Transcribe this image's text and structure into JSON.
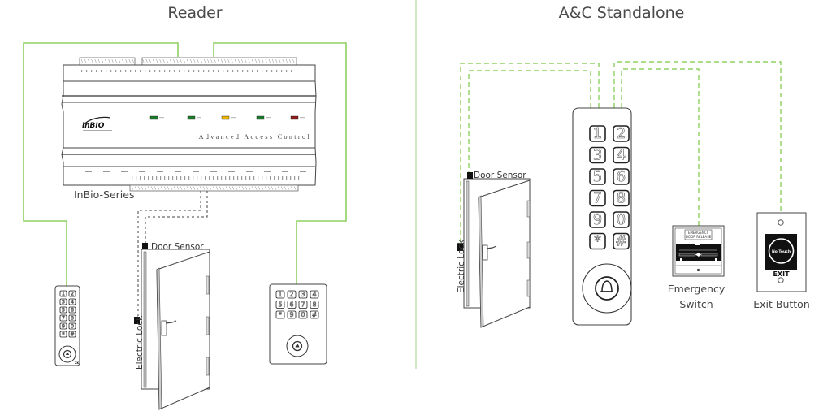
{
  "diagram": {
    "panels": [
      {
        "title": "Reader",
        "controller": {
          "series_label": "InBio-Series",
          "brand_text": "Advanced Access Control",
          "logo": "inBIO",
          "leds": [
            {
              "color": "#1a7a2a"
            },
            {
              "color": "#1a7a2a"
            },
            {
              "color": "#e8b400"
            },
            {
              "color": "#1a7a2a"
            },
            {
              "color": "#8b1a1a"
            }
          ]
        },
        "door": {
          "sensor_label": "Door Sensor",
          "lock_label": "Electric Lock"
        },
        "readers": [
          {
            "type": "slim-keypad-reader",
            "keys": [
              "1",
              "2",
              "3",
              "4",
              "5",
              "6",
              "7",
              "8",
              "9",
              "0",
              "*",
              "#"
            ]
          },
          {
            "type": "wide-keypad-reader",
            "keys": [
              "1",
              "2",
              "3",
              "4",
              "5",
              "6",
              "7",
              "8",
              "*",
              "9",
              "0",
              "#"
            ]
          }
        ]
      },
      {
        "title": "A&C Standalone",
        "keypad": {
          "keys": [
            "1",
            "2",
            "3",
            "4",
            "5",
            "6",
            "7",
            "8",
            "9",
            "0",
            "*",
            "#"
          ]
        },
        "door": {
          "sensor_label": "Door Sensor",
          "lock_label": "Electric Lock"
        },
        "emergency_switch": {
          "label_line1": "Emergency",
          "label_line2": "Switch",
          "plate_line1": "EMERGENCY",
          "plate_line2": "DOOR RELEASE"
        },
        "exit_button": {
          "label": "Exit Button",
          "button_text": "No Touch",
          "exit_text": "EXIT"
        }
      }
    ],
    "colors": {
      "wire": "#8fd060",
      "divider": "#bfe0a8",
      "outline": "#444444"
    }
  }
}
